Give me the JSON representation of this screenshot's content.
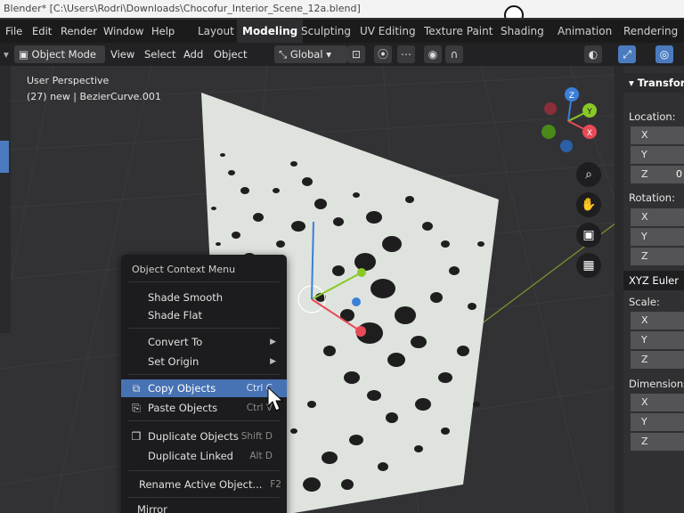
{
  "window": {
    "title": "Blender* [C:\\Users\\Rodri\\Downloads\\Chocofur_Interior_Scene_12a.blend]"
  },
  "menubar": {
    "items": [
      "File",
      "Edit",
      "Render",
      "Window",
      "Help"
    ],
    "workspaces": [
      "Layout",
      "Modeling",
      "Sculpting",
      "UV Editing",
      "Texture Paint",
      "Shading",
      "Animation",
      "Rendering"
    ],
    "active_workspace": "Modeling"
  },
  "header": {
    "mode": "Object Mode",
    "menus": [
      "View",
      "Select",
      "Add",
      "Object"
    ],
    "orientation": "Global"
  },
  "viewport": {
    "perspective": "User Perspective",
    "object_info": "(27) new | BezierCurve.001",
    "gizmo_labels": {
      "z": "Z",
      "y": "Y",
      "x": "X"
    }
  },
  "context_menu": {
    "title": "Object Context Menu",
    "items": [
      {
        "label": "Shade Smooth",
        "shortcut": ""
      },
      {
        "label": "Shade Flat",
        "shortcut": ""
      },
      {
        "label": "Convert To",
        "shortcut": "",
        "submenu": true
      },
      {
        "label": "Set Origin",
        "shortcut": "",
        "submenu": true
      },
      {
        "label": "Copy Objects",
        "shortcut": "Ctrl C",
        "highlighted": true
      },
      {
        "label": "Paste Objects",
        "shortcut": "Ctrl V"
      },
      {
        "label": "Duplicate Objects",
        "shortcut": "Shift D"
      },
      {
        "label": "Duplicate Linked",
        "shortcut": "Alt D"
      },
      {
        "label": "Rename Active Object...",
        "shortcut": "F2"
      },
      {
        "label": "Mirror",
        "shortcut": ""
      }
    ]
  },
  "sidebar": {
    "panel_title": "Transform",
    "location_label": "Location:",
    "rotation_label": "Rotation:",
    "scale_label": "Scale:",
    "dimensions_label": "Dimensions:",
    "rotation_mode": "XYZ Euler",
    "axes": [
      "X",
      "Y",
      "Z"
    ],
    "location_z_value": "0"
  },
  "colors": {
    "accent": "#4772b3",
    "axis_x": "#e84a55",
    "axis_y": "#8ac926",
    "axis_z": "#3a7fd9"
  }
}
